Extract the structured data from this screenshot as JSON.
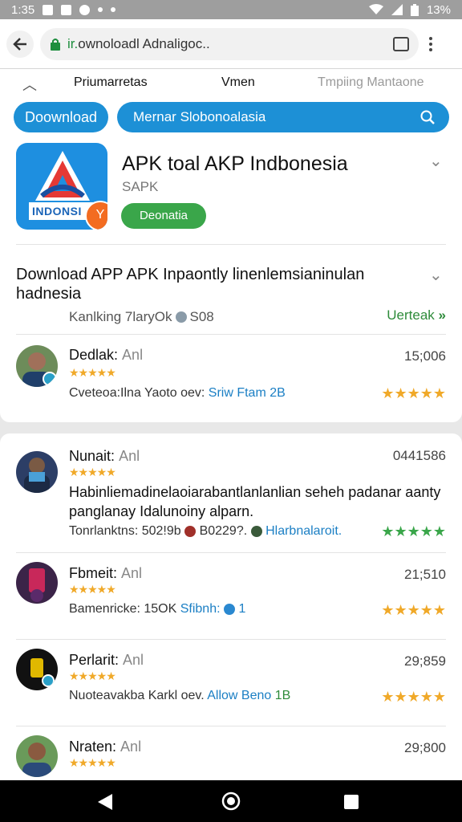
{
  "status": {
    "time": "1:35",
    "battery": "13%"
  },
  "browser": {
    "url_prefix": "ir.",
    "url_text": "ownoloadl Adnaligoc.."
  },
  "subnav": {
    "item1": "Priumarretas",
    "item2": "Vmen",
    "item3": "Tmpiing Mantaone"
  },
  "toolbar": {
    "download": "Doownload",
    "search": "Mernar Slobonoalasia"
  },
  "app": {
    "icon_badge": "INDONSI",
    "title": "APK toal AKP Indbonesia",
    "subtitle": "SAPK",
    "button": "Deonatia"
  },
  "section": {
    "heading": "Download APP APK Inpaontly linenlemsianinulan hadnesia",
    "meta_left": "Kanlking 7laryOk",
    "meta_right": "S08",
    "update": "Uerteak"
  },
  "reviews": [
    {
      "name": "Dedlak:",
      "suffix": "Anl",
      "number": "15;006",
      "line_prefix": "Cveteoa:Ilna Yaoto oev:",
      "line_link": "Sriw Ftam",
      "line_tag": "2B",
      "stars_color": "#f0a929"
    },
    {
      "name": "Nunait:",
      "suffix": "Anl",
      "number": "0441586",
      "body": "Habinliemadinelaoiarabantlanlanlian seheh padanar aanty panglanay Idalunoiny alparn.",
      "line_prefix": "Tonrlanktns: 502!9b",
      "line_mid": "B0229?.",
      "line_link": "Hlarbnalaroit.",
      "stars_color": "#3aa64a"
    },
    {
      "name": "Fbmeit:",
      "suffix": "Anl",
      "number": "21;510",
      "line_prefix": "Bamenricke: 15OK",
      "line_link": "Sfibnh:",
      "line_tag": "1",
      "stars_color": "#f0a929"
    },
    {
      "name": "Perlarit:",
      "suffix": "Anl",
      "number": "29;859",
      "line_prefix": "Nuoteavakba Karkl oev.",
      "line_link": "Allow Beno",
      "line_tag": "1B",
      "stars_color": "#f0a929"
    },
    {
      "name": "Nraten:",
      "suffix": "Anl",
      "number": "29;800",
      "stars_color": "#f0a929"
    }
  ],
  "stars": {
    "small": "★★★★★",
    "big": "★★★★★"
  }
}
